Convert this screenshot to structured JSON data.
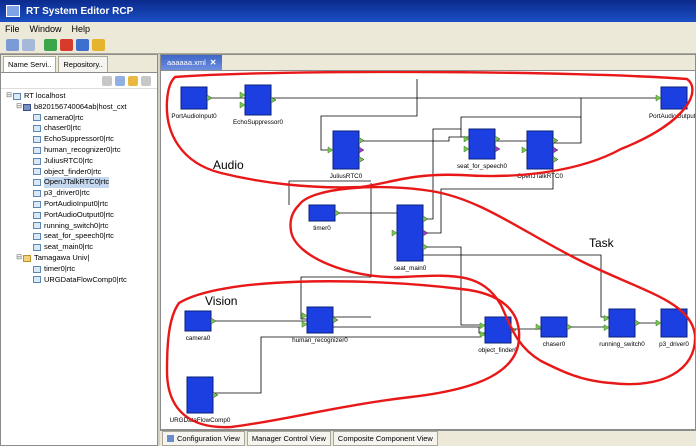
{
  "window": {
    "title": "RT System Editor RCP"
  },
  "menu": [
    "File",
    "Window",
    "Help"
  ],
  "left_panel": {
    "tabs": [
      "Name Servi..",
      "Repository.."
    ],
    "tree": [
      {
        "label": "RT localhost",
        "level": 0,
        "kind": "root",
        "expander": "⊟"
      },
      {
        "label": "b820156740064ab|host_cxt",
        "level": 1,
        "kind": "host",
        "expander": "⊟"
      },
      {
        "label": "camera0|rtc",
        "level": 2,
        "kind": "rtc"
      },
      {
        "label": "chaser0|rtc",
        "level": 2,
        "kind": "rtc"
      },
      {
        "label": "EchoSuppressor0|rtc",
        "level": 2,
        "kind": "rtc"
      },
      {
        "label": "human_recognizer0|rtc",
        "level": 2,
        "kind": "rtc"
      },
      {
        "label": "JuliusRTC0|rtc",
        "level": 2,
        "kind": "rtc"
      },
      {
        "label": "object_finder0|rtc",
        "level": 2,
        "kind": "rtc"
      },
      {
        "label": "OpenJTalkRTC0|rtc",
        "level": 2,
        "kind": "rtc",
        "selected": true
      },
      {
        "label": "p3_driver0|rtc",
        "level": 2,
        "kind": "rtc"
      },
      {
        "label": "PortAudioInput0|rtc",
        "level": 2,
        "kind": "rtc"
      },
      {
        "label": "PortAudioOutput0|rtc",
        "level": 2,
        "kind": "rtc"
      },
      {
        "label": "running_switch0|rtc",
        "level": 2,
        "kind": "rtc"
      },
      {
        "label": "seat_for_speech0|rtc",
        "level": 2,
        "kind": "rtc"
      },
      {
        "label": "seat_main0|rtc",
        "level": 2,
        "kind": "rtc"
      },
      {
        "label": "Tamagawa Univ|",
        "level": 1,
        "kind": "folder",
        "expander": "⊟"
      },
      {
        "label": "timer0|rtc",
        "level": 2,
        "kind": "rtc"
      },
      {
        "label": "URGDataFlowComp0|rtc",
        "level": 2,
        "kind": "rtc"
      }
    ]
  },
  "editor": {
    "tab_label": "aaaaaa.xml",
    "tab_close": "✕",
    "components": [
      {
        "id": "PortAudioInput0",
        "label": "PortAudioInput0"
      },
      {
        "id": "EchoSuppressor0",
        "label": "EchoSuppressor0"
      },
      {
        "id": "PortAudioOutput0",
        "label": "PortAudioOutput0"
      },
      {
        "id": "JuliusRTC0",
        "label": "JuliusRTC0"
      },
      {
        "id": "seat_for_speech0",
        "label": "seat_for_speech0"
      },
      {
        "id": "OpenJTalkRTC0",
        "label": "OpenJTalkRTC0"
      },
      {
        "id": "timer0",
        "label": "timer0"
      },
      {
        "id": "seat_main0",
        "label": "seat_main0"
      },
      {
        "id": "camera0",
        "label": "camera0"
      },
      {
        "id": "human_recognizer0",
        "label": "human_recognizer0"
      },
      {
        "id": "object_finder0",
        "label": "object_finder0"
      },
      {
        "id": "chaser0",
        "label": "chaser0"
      },
      {
        "id": "running_switch0",
        "label": "running_switch0"
      },
      {
        "id": "p3_driver0",
        "label": "p3_driver0"
      },
      {
        "id": "URGDataFlowComp0",
        "label": "URGDataFlowComp0"
      }
    ],
    "annotations": {
      "audio": "Audio",
      "task": "Task",
      "vision": "Vision"
    }
  },
  "bottom_tabs": [
    "Configuration View",
    "Manager Control View",
    "Composite Component View"
  ],
  "colors": {
    "component": "#1b3fe0",
    "port_in": "#78c850",
    "port_out": "#a03cc8",
    "annotation": "#e81818",
    "title": "#0b2a8c"
  }
}
